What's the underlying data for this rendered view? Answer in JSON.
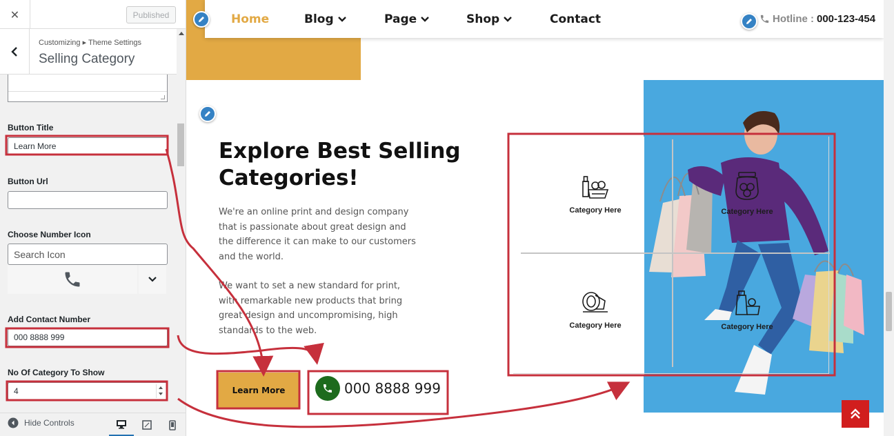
{
  "customizer": {
    "close_label": "✕",
    "published_label": "Published",
    "breadcrumb": "Customizing ▸ Theme Settings",
    "section_title": "Selling Category",
    "fields": {
      "button_title_label": "Button Title",
      "button_title_value": "Learn More",
      "button_url_label": "Button Url",
      "button_url_value": "",
      "number_icon_label": "Choose Number Icon",
      "search_icon_placeholder": "Search Icon",
      "contact_number_label": "Add Contact Number",
      "contact_number_value": "000 8888 999",
      "category_count_label": "No Of Category To Show",
      "category_count_value": "4"
    },
    "footer": {
      "hide_controls_label": "Hide Controls"
    }
  },
  "preview": {
    "nav": {
      "items": [
        {
          "label": "Home",
          "active": true
        },
        {
          "label": "Blog",
          "dropdown": true
        },
        {
          "label": "Page",
          "dropdown": true
        },
        {
          "label": "Shop",
          "dropdown": true
        },
        {
          "label": "Contact"
        }
      ],
      "hotline_label": "Hotline :",
      "hotline_number": "000-123-454"
    },
    "section": {
      "heading": "Explore Best Selling Categories!",
      "paragraph_1": "We're an online print and design company that is passionate about great design and the difference it can make to our customers and the world.",
      "paragraph_2": "We want to set a new standard for print, with remarkable new products that bring great design and uncompromising, high standards to the web.",
      "button_label": "Learn More",
      "contact_number": "000 8888 999"
    },
    "categories": [
      {
        "label": "Category Here",
        "icon": "grocery-basket-icon"
      },
      {
        "label": "Category Here",
        "icon": "jar-icon"
      },
      {
        "label": "Category Here",
        "icon": "meat-icon"
      },
      {
        "label": "Category Here",
        "icon": "bottle-icon"
      }
    ]
  },
  "colors": {
    "accent": "#e2a944",
    "annotation": "#c6303c",
    "edit_pencil": "#3582c4",
    "phone_green": "#1d6b1d",
    "scroll_top": "#d11e1e",
    "photo_bg": "#49a8df"
  }
}
